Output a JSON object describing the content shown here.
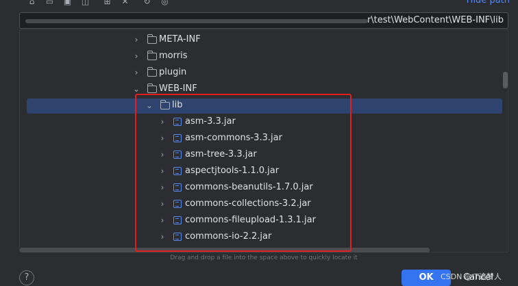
{
  "toolbar": {
    "icons": [
      "home-icon",
      "desktop-icon",
      "project-icon",
      "module-icon",
      "new-folder-icon",
      "delete-icon",
      "refresh-icon",
      "show-hidden-icon"
    ],
    "hide_path_label": "Hide path"
  },
  "path": {
    "value": "r\\test\\WebContent\\WEB-INF\\lib"
  },
  "tree": {
    "items": [
      {
        "label": "META-INF",
        "type": "folder",
        "expanded": false
      },
      {
        "label": "morris",
        "type": "folder",
        "expanded": false
      },
      {
        "label": "plugin",
        "type": "folder",
        "expanded": false
      },
      {
        "label": "WEB-INF",
        "type": "folder",
        "expanded": true
      },
      {
        "label": "lib",
        "type": "folder",
        "expanded": true,
        "selected": true
      },
      {
        "label": "asm-3.3.jar",
        "type": "jar",
        "expanded": false
      },
      {
        "label": "asm-commons-3.3.jar",
        "type": "jar",
        "expanded": false
      },
      {
        "label": "asm-tree-3.3.jar",
        "type": "jar",
        "expanded": false
      },
      {
        "label": "aspectjtools-1.1.0.jar",
        "type": "jar",
        "expanded": false
      },
      {
        "label": "commons-beanutils-1.7.0.jar",
        "type": "jar",
        "expanded": false
      },
      {
        "label": "commons-collections-3.2.jar",
        "type": "jar",
        "expanded": false
      },
      {
        "label": "commons-fileupload-1.3.1.jar",
        "type": "jar",
        "expanded": false
      },
      {
        "label": "commons-io-2.2.jar",
        "type": "jar",
        "expanded": false
      }
    ]
  },
  "hint": "Drag and drop a file into the space above to quickly locate it",
  "buttons": {
    "help": "?",
    "ok": "OK",
    "cancel": "Cancel"
  },
  "watermark": "CSDN @IT追梦人",
  "colors": {
    "background": "#2b2d30",
    "selection": "#2e436e",
    "accent": "#3574f0",
    "highlight_box": "#e0201c",
    "jar_icon": "#548af7"
  }
}
